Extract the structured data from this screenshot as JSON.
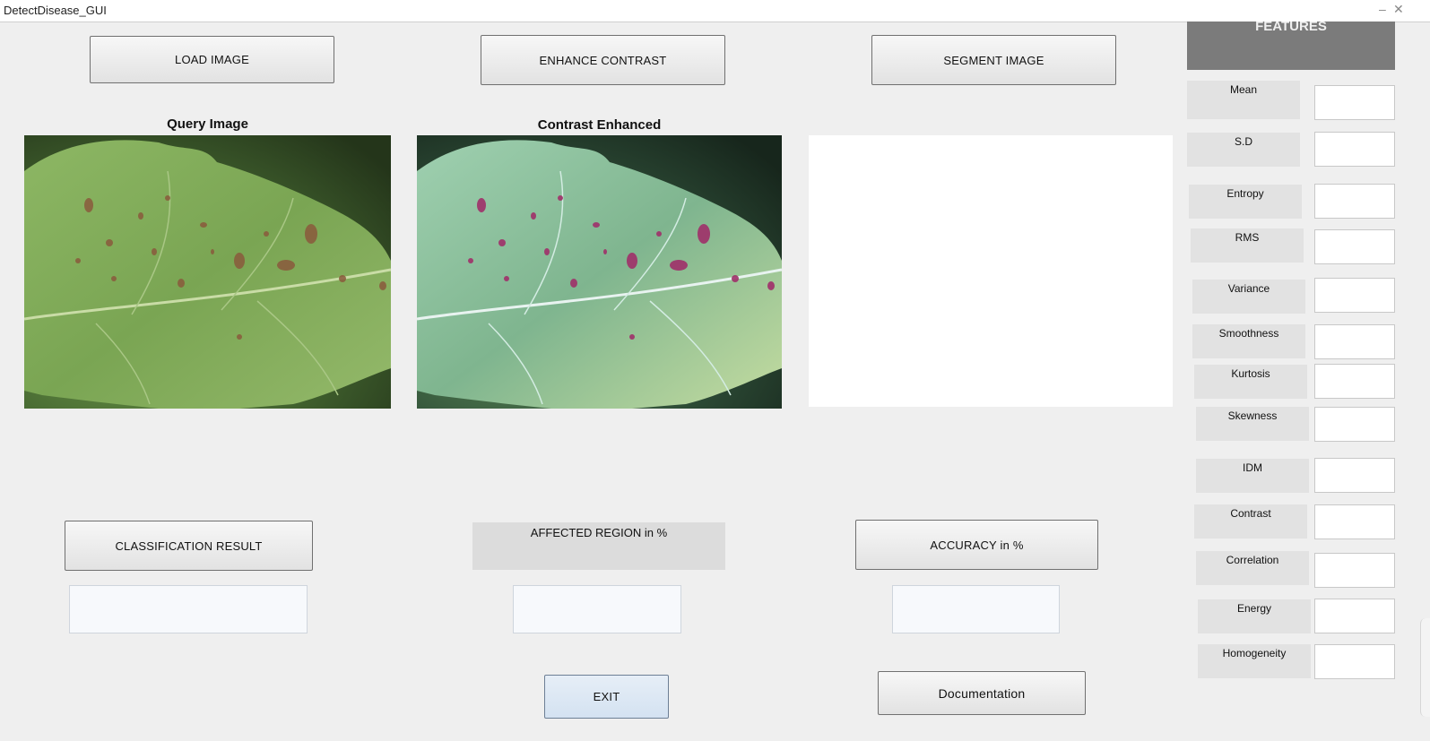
{
  "window": {
    "title": "DetectDisease_GUI",
    "minimize_glyph": "–",
    "close_glyph": "✕"
  },
  "buttons": {
    "load_image": "LOAD IMAGE",
    "enhance_contrast": "ENHANCE CONTRAST",
    "segment_image": "SEGMENT IMAGE",
    "classification_result": "CLASSIFICATION RESULT",
    "accuracy": "ACCURACY in %",
    "exit": "EXIT",
    "documentation": "Documentation"
  },
  "labels": {
    "affected_region": "AFFECTED REGION in %",
    "query_image": "Query Image",
    "contrast_enhanced": "Contrast Enhanced"
  },
  "results": {
    "classification": "",
    "affected_region": "",
    "accuracy": ""
  },
  "features": {
    "header": "FEATURES",
    "items": [
      {
        "label": "Mean",
        "value": ""
      },
      {
        "label": "S.D",
        "value": ""
      },
      {
        "label": "Entropy",
        "value": ""
      },
      {
        "label": "RMS",
        "value": ""
      },
      {
        "label": "Variance",
        "value": ""
      },
      {
        "label": "Smoothness",
        "value": ""
      },
      {
        "label": "Kurtosis",
        "value": ""
      },
      {
        "label": "Skewness",
        "value": ""
      },
      {
        "label": "IDM",
        "value": ""
      },
      {
        "label": "Contrast",
        "value": ""
      },
      {
        "label": "Correlation",
        "value": ""
      },
      {
        "label": "Energy",
        "value": ""
      },
      {
        "label": "Homogeneity",
        "value": ""
      }
    ]
  },
  "colors": {
    "background": "#efefef",
    "leaf_original": "#7fa857",
    "leaf_enhanced": "#8fc2a0",
    "features_header": "#7b7b7b"
  }
}
